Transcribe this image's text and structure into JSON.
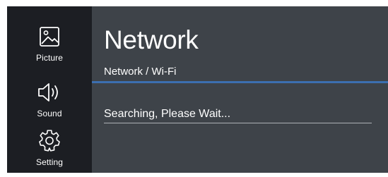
{
  "sidebar": {
    "items": [
      {
        "id": "picture",
        "icon": "picture-icon",
        "label": "Picture"
      },
      {
        "id": "sound",
        "icon": "speaker-icon",
        "label": "Sound"
      },
      {
        "id": "setting",
        "icon": "gear-icon",
        "label": "Setting"
      }
    ]
  },
  "header": {
    "title": "Network",
    "breadcrumb": "Network / Wi-Fi"
  },
  "content": {
    "status": "Searching, Please Wait..."
  },
  "colors": {
    "sidebar_bg": "#1c1e23",
    "panel_bg": "#3e4349",
    "accent_divider": "#3c6fb0",
    "text": "#ffffff"
  }
}
